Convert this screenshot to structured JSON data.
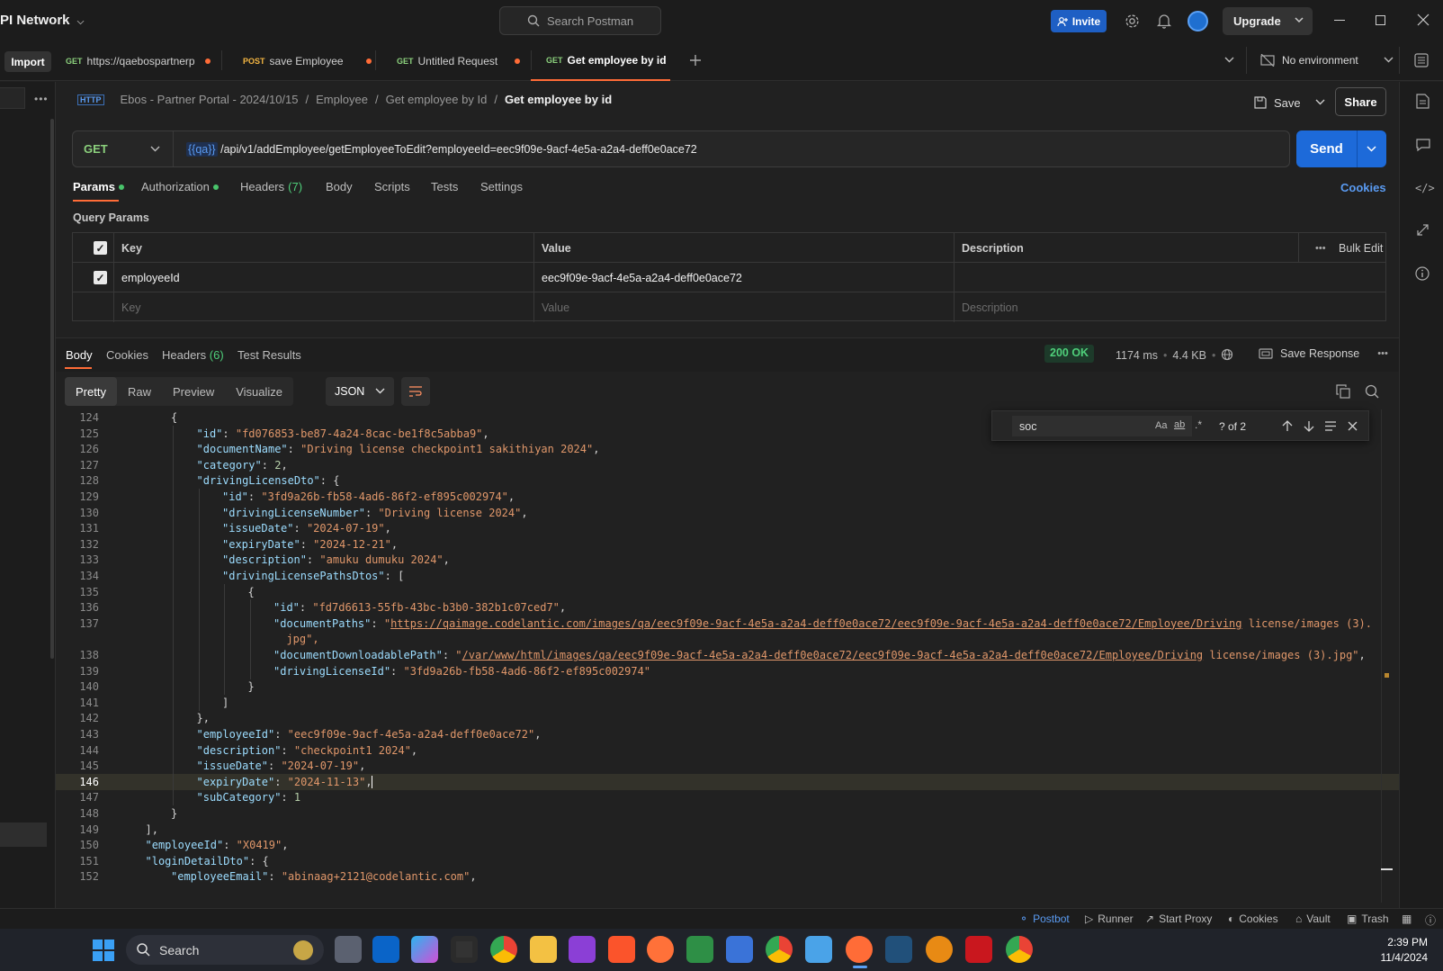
{
  "app": {
    "workspace_name": "PI Network",
    "search_placeholder": "Search Postman",
    "invite_label": "Invite",
    "upgrade_label": "Upgrade",
    "import_label": "Import",
    "environment": "No environment"
  },
  "tabs": [
    {
      "method": "GET",
      "label": "https://qaebospartnerp",
      "method_color": "#8cd17d"
    },
    {
      "method": "POST",
      "label": "save Employee",
      "method_color": "#f5b642"
    },
    {
      "method": "GET",
      "label": "Untitled Request",
      "method_color": "#8cd17d"
    },
    {
      "method": "GET",
      "label": "Get employee by id",
      "method_color": "#8cd17d"
    }
  ],
  "breadcrumb": {
    "items": [
      "Ebos - Partner Portal - 2024/10/15",
      "Employee",
      "Get employee by Id"
    ],
    "current": "Get employee by id",
    "separator": "/"
  },
  "request": {
    "save_label": "Save",
    "share_label": "Share",
    "method": "GET",
    "url_variable": "{{qa}}",
    "url_path": "/api/v1/addEmployee/getEmployeeToEdit?employeeId=eec9f09e-9acf-4e5a-a2a4-deff0e0ace72",
    "send_label": "Send",
    "tabs": [
      {
        "label": "Params"
      },
      {
        "label": "Authorization"
      },
      {
        "label": "Headers",
        "count": "(7)"
      },
      {
        "label": "Body"
      },
      {
        "label": "Scripts"
      },
      {
        "label": "Tests"
      },
      {
        "label": "Settings"
      }
    ],
    "cookies_label": "Cookies",
    "query_params_title": "Query Params",
    "table": {
      "headers": [
        "Key",
        "Value",
        "Description"
      ],
      "bulk_edit_label": "Bulk Edit",
      "rows": [
        {
          "key": "employeeId",
          "value": "eec9f09e-9acf-4e5a-a2a4-deff0e0ace72",
          "description": ""
        }
      ],
      "placeholders": {
        "key": "Key",
        "value": "Value",
        "description": "Description"
      }
    }
  },
  "response": {
    "tabs": [
      {
        "label": "Body"
      },
      {
        "label": "Cookies"
      },
      {
        "label": "Headers",
        "count": "(6)"
      },
      {
        "label": "Test Results"
      }
    ],
    "status": "200 OK",
    "time": "1174 ms",
    "size": "4.4 KB",
    "save_response_label": "Save Response",
    "view_modes": [
      "Pretty",
      "Raw",
      "Preview",
      "Visualize"
    ],
    "format": "JSON",
    "find": {
      "query": "soc",
      "match_case": "Aa",
      "whole_word": "ab",
      "count": "? of 2"
    },
    "code_lines": [
      {
        "n": "124",
        "d": 2,
        "t": "{"
      },
      {
        "n": "125",
        "d": 3,
        "t": "\"id\": \"fd076853-be87-4a24-8cac-be1f8c5abba9\","
      },
      {
        "n": "126",
        "d": 3,
        "t": "\"documentName\": \"Driving license checkpoint1 sakithiyan 2024\","
      },
      {
        "n": "127",
        "d": 3,
        "t": "\"category\": 2,"
      },
      {
        "n": "128",
        "d": 3,
        "t": "\"drivingLicenseDto\": {"
      },
      {
        "n": "129",
        "d": 4,
        "t": "\"id\": \"3fd9a26b-fb58-4ad6-86f2-ef895c002974\","
      },
      {
        "n": "130",
        "d": 4,
        "t": "\"drivingLicenseNumber\": \"Driving license 2024\","
      },
      {
        "n": "131",
        "d": 4,
        "t": "\"issueDate\": \"2024-07-19\","
      },
      {
        "n": "132",
        "d": 4,
        "t": "\"expiryDate\": \"2024-12-21\","
      },
      {
        "n": "133",
        "d": 4,
        "t": "\"description\": \"amuku dumuku 2024\","
      },
      {
        "n": "134",
        "d": 4,
        "t": "\"drivingLicensePathsDtos\": ["
      },
      {
        "n": "135",
        "d": 5,
        "t": "{"
      },
      {
        "n": "136",
        "d": 6,
        "t": "\"id\": \"fd7d6613-55fb-43bc-b3b0-382b1c07ced7\","
      },
      {
        "n": "137",
        "d": 6,
        "t": "\"documentPaths\": \"https://qaimage.codelantic.com/images/qa/eec9f09e-9acf-4e5a-a2a4-deff0e0ace72/eec9f09e-9acf-4e5a-a2a4-deff0e0ace72/Employee/Driving license/images (3)."
      },
      {
        "n": "",
        "d": 6,
        "t": "  jpg\","
      },
      {
        "n": "138",
        "d": 6,
        "t": "\"documentDownloadablePath\": \"/var/www/html/images/qa/eec9f09e-9acf-4e5a-a2a4-deff0e0ace72/eec9f09e-9acf-4e5a-a2a4-deff0e0ace72/Employee/Driving license/images (3).jpg\","
      },
      {
        "n": "139",
        "d": 6,
        "t": "\"drivingLicenseId\": \"3fd9a26b-fb58-4ad6-86f2-ef895c002974\""
      },
      {
        "n": "140",
        "d": 5,
        "t": "}"
      },
      {
        "n": "141",
        "d": 4,
        "t": "]"
      },
      {
        "n": "142",
        "d": 3,
        "t": "},"
      },
      {
        "n": "143",
        "d": 3,
        "t": "\"employeeId\": \"eec9f09e-9acf-4e5a-a2a4-deff0e0ace72\","
      },
      {
        "n": "144",
        "d": 3,
        "t": "\"description\": \"checkpoint1 2024\","
      },
      {
        "n": "145",
        "d": 3,
        "t": "\"issueDate\": \"2024-07-19\","
      },
      {
        "n": "146",
        "d": 3,
        "t": "\"expiryDate\": \"2024-11-13\",",
        "current": true
      },
      {
        "n": "147",
        "d": 3,
        "t": "\"subCategory\": 1"
      },
      {
        "n": "148",
        "d": 2,
        "t": "}"
      },
      {
        "n": "149",
        "d": 1,
        "t": "],"
      },
      {
        "n": "150",
        "d": 1,
        "t": "\"employeeId\": \"X0419\","
      },
      {
        "n": "151",
        "d": 1,
        "t": "\"loginDetailDto\": {"
      },
      {
        "n": "152",
        "d": 2,
        "t": "\"employeeEmail\": \"abinaag+2121@codelantic.com\","
      }
    ]
  },
  "statusbar": {
    "postbot": "Postbot",
    "runner": "Runner",
    "start_proxy": "Start Proxy",
    "cookies": "Cookies",
    "vault": "Vault",
    "trash": "Trash"
  },
  "taskbar": {
    "search_label": "Search",
    "time": "2:39 PM",
    "date": "11/4/2024"
  },
  "colors": {
    "accent": "#ff6c37",
    "send_blue": "#1d6ad9",
    "get_green": "#8cd17d",
    "post_yellow": "#f5b642",
    "status_green": "#4fcf7a"
  }
}
